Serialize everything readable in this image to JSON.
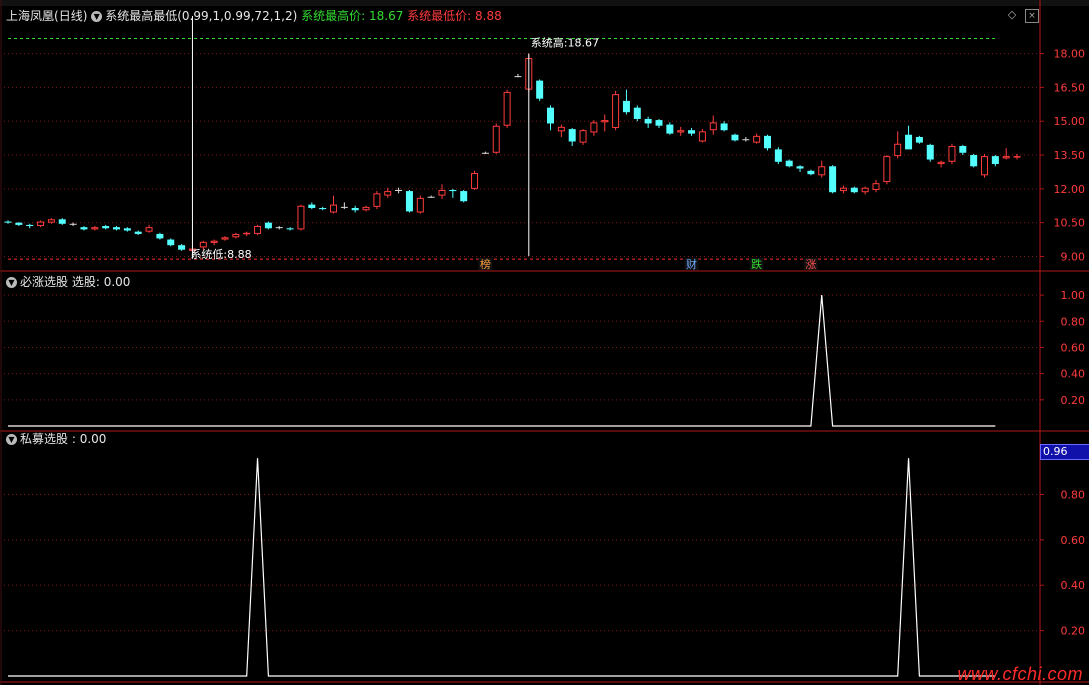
{
  "header": {
    "stock_name": "上海凤凰",
    "period": "(日线)",
    "indicator_name": "系统最高最低",
    "indicator_params": "(0.99,1,0.99,72,1,2)",
    "high_label": "系统最高价:",
    "high_value": "18.67",
    "low_label": "系统最低价:",
    "low_value": "8.88"
  },
  "annotations": {
    "high_text": "系统高:18.67",
    "low_text": "系统低:8.88"
  },
  "event_markers": [
    {
      "label": "榜",
      "color": "#ffa040",
      "bar": 44
    },
    {
      "label": "财",
      "color": "#6fa8ff",
      "bar": 63
    },
    {
      "label": "跌",
      "color": "#33dd33",
      "bar": 69
    },
    {
      "label": "涨",
      "color": "#ff5050",
      "bar": 74
    }
  ],
  "panel2": {
    "title": "必涨选股",
    "series_label": "选股: 0.00"
  },
  "panel3": {
    "title": "私募选股",
    "series_label": ": 0.00",
    "value_box": "0.96"
  },
  "watermark": "www.cfchi.com",
  "chart_data": [
    {
      "type": "candlestick",
      "title": "上海凤凰(日线)",
      "ylim": [
        8.4,
        19.4
      ],
      "yticks": [
        "18.00",
        "16.50",
        "15.00",
        "13.50",
        "12.00",
        "10.50",
        "9.00"
      ],
      "ytick_values": [
        18.0,
        16.5,
        15.0,
        13.5,
        12.0,
        10.5,
        9.0
      ],
      "reference_lines": {
        "high": 18.67,
        "low": 8.88
      },
      "colors": {
        "up": "#ff3c3c",
        "down": "#54ffff",
        "flat": "#dddddd"
      },
      "ohlc": [
        [
          10.55,
          10.6,
          10.45,
          10.5
        ],
        [
          10.5,
          10.52,
          10.35,
          10.4
        ],
        [
          10.4,
          10.45,
          10.25,
          10.35
        ],
        [
          10.35,
          10.6,
          10.3,
          10.55
        ],
        [
          10.5,
          10.7,
          10.45,
          10.65
        ],
        [
          10.65,
          10.7,
          10.4,
          10.45
        ],
        [
          10.45,
          10.5,
          10.35,
          10.45
        ],
        [
          10.3,
          10.35,
          10.15,
          10.2
        ],
        [
          10.2,
          10.35,
          10.15,
          10.3
        ],
        [
          10.35,
          10.4,
          10.2,
          10.25
        ],
        [
          10.3,
          10.35,
          10.15,
          10.2
        ],
        [
          10.25,
          10.3,
          10.1,
          10.15
        ],
        [
          10.1,
          10.15,
          9.95,
          10.0
        ],
        [
          10.1,
          10.4,
          10.05,
          10.3
        ],
        [
          10.0,
          10.05,
          9.75,
          9.8
        ],
        [
          9.75,
          9.8,
          9.45,
          9.5
        ],
        [
          9.5,
          9.55,
          9.25,
          9.3
        ],
        [
          9.25,
          9.4,
          8.9,
          9.35
        ],
        [
          9.4,
          9.7,
          9.3,
          9.65
        ],
        [
          9.6,
          9.75,
          9.5,
          9.7
        ],
        [
          9.75,
          9.9,
          9.7,
          9.85
        ],
        [
          9.85,
          10.05,
          9.8,
          10.0
        ],
        [
          10.0,
          10.1,
          9.9,
          10.05
        ],
        [
          10.0,
          10.4,
          9.95,
          10.35
        ],
        [
          10.5,
          10.55,
          10.2,
          10.25
        ],
        [
          10.3,
          10.35,
          10.2,
          10.3
        ],
        [
          10.25,
          10.3,
          10.15,
          10.2
        ],
        [
          10.2,
          11.3,
          10.15,
          11.25
        ],
        [
          11.3,
          11.4,
          11.1,
          11.15
        ],
        [
          11.15,
          11.2,
          11.05,
          11.1
        ],
        [
          10.95,
          11.7,
          10.9,
          11.3
        ],
        [
          11.2,
          11.4,
          11.1,
          11.2
        ],
        [
          11.15,
          11.25,
          10.95,
          11.05
        ],
        [
          11.05,
          11.25,
          11.0,
          11.2
        ],
        [
          11.2,
          11.9,
          11.1,
          11.8
        ],
        [
          11.7,
          12.05,
          11.6,
          11.9
        ],
        [
          11.95,
          12.05,
          11.8,
          11.95
        ],
        [
          11.9,
          11.95,
          10.95,
          11.0
        ],
        [
          10.95,
          11.7,
          10.9,
          11.6
        ],
        [
          11.65,
          11.7,
          11.6,
          11.65
        ],
        [
          11.7,
          12.2,
          11.55,
          11.95
        ],
        [
          11.95,
          12.0,
          11.6,
          11.9
        ],
        [
          11.9,
          11.95,
          11.4,
          11.45
        ],
        [
          12.0,
          12.8,
          11.95,
          12.7
        ],
        [
          13.6,
          13.65,
          13.55,
          13.6
        ],
        [
          13.6,
          14.9,
          13.55,
          14.8
        ],
        [
          14.8,
          16.4,
          14.7,
          16.3
        ],
        [
          17.0,
          17.1,
          16.95,
          17.0
        ],
        [
          16.4,
          18.0,
          16.3,
          17.8
        ],
        [
          16.8,
          16.85,
          15.9,
          16.0
        ],
        [
          15.6,
          15.7,
          14.6,
          14.9
        ],
        [
          14.55,
          14.85,
          14.3,
          14.75
        ],
        [
          14.65,
          14.7,
          13.9,
          14.1
        ],
        [
          14.05,
          14.65,
          13.95,
          14.6
        ],
        [
          14.5,
          15.05,
          14.35,
          14.95
        ],
        [
          14.95,
          15.3,
          14.55,
          15.05
        ],
        [
          14.7,
          16.35,
          14.6,
          16.2
        ],
        [
          15.9,
          16.4,
          15.3,
          15.4
        ],
        [
          15.6,
          15.7,
          15.0,
          15.1
        ],
        [
          15.1,
          15.2,
          14.7,
          14.9
        ],
        [
          15.05,
          15.1,
          14.7,
          14.8
        ],
        [
          14.85,
          14.95,
          14.4,
          14.45
        ],
        [
          14.5,
          14.75,
          14.35,
          14.6
        ],
        [
          14.6,
          14.7,
          14.35,
          14.45
        ],
        [
          14.1,
          14.65,
          14.05,
          14.55
        ],
        [
          14.6,
          15.25,
          14.4,
          14.95
        ],
        [
          14.9,
          15.0,
          14.55,
          14.6
        ],
        [
          14.4,
          14.45,
          14.1,
          14.15
        ],
        [
          14.2,
          14.3,
          14.1,
          14.2
        ],
        [
          14.05,
          14.45,
          14.0,
          14.35
        ],
        [
          14.35,
          14.4,
          13.7,
          13.8
        ],
        [
          13.75,
          13.85,
          13.1,
          13.2
        ],
        [
          13.25,
          13.3,
          12.95,
          13.0
        ],
        [
          13.0,
          13.05,
          12.75,
          12.9
        ],
        [
          12.8,
          12.85,
          12.6,
          12.65
        ],
        [
          12.6,
          13.25,
          12.5,
          13.0
        ],
        [
          13.0,
          13.05,
          11.8,
          11.85
        ],
        [
          11.9,
          12.15,
          11.8,
          12.05
        ],
        [
          12.05,
          12.1,
          11.8,
          11.85
        ],
        [
          11.85,
          12.1,
          11.75,
          12.05
        ],
        [
          11.95,
          12.4,
          11.85,
          12.25
        ],
        [
          12.3,
          13.5,
          12.2,
          13.45
        ],
        [
          13.45,
          14.55,
          13.35,
          14.0
        ],
        [
          14.4,
          14.8,
          13.9,
          13.75
        ],
        [
          14.3,
          14.35,
          14.0,
          14.05
        ],
        [
          13.95,
          14.0,
          13.2,
          13.3
        ],
        [
          13.1,
          13.25,
          12.95,
          13.2
        ],
        [
          13.2,
          14.0,
          13.1,
          13.9
        ],
        [
          13.9,
          13.95,
          13.5,
          13.6
        ],
        [
          13.5,
          13.55,
          12.95,
          13.0
        ],
        [
          12.6,
          13.55,
          12.5,
          13.45
        ],
        [
          13.45,
          13.5,
          13.0,
          13.1
        ],
        [
          13.35,
          13.8,
          13.3,
          13.45
        ],
        [
          13.4,
          13.55,
          13.3,
          13.45
        ]
      ]
    },
    {
      "type": "line",
      "title": "必涨选股",
      "series": [
        {
          "name": "选股",
          "values": [
            0,
            0,
            1,
            0,
            0
          ]
        }
      ],
      "x": [
        0,
        74,
        75,
        76,
        91
      ],
      "ylim": [
        0,
        1.1
      ],
      "yticks": [
        "1.00",
        "0.80",
        "0.60",
        "0.40",
        "0.20"
      ],
      "ytick_values": [
        1.0,
        0.8,
        0.6,
        0.4,
        0.2
      ]
    },
    {
      "type": "line",
      "title": "私募选股",
      "series": [
        {
          "name": "",
          "values": [
            0,
            0,
            0.96,
            0,
            0,
            0,
            0.96,
            0,
            0
          ]
        }
      ],
      "x": [
        0,
        22,
        23,
        24,
        50,
        82,
        83,
        84,
        91
      ],
      "ylim": [
        0,
        1.04
      ],
      "yticks": [
        "0.80",
        "0.60",
        "0.40",
        "0.20"
      ],
      "ytick_values": [
        0.8,
        0.6,
        0.4,
        0.2
      ]
    }
  ]
}
